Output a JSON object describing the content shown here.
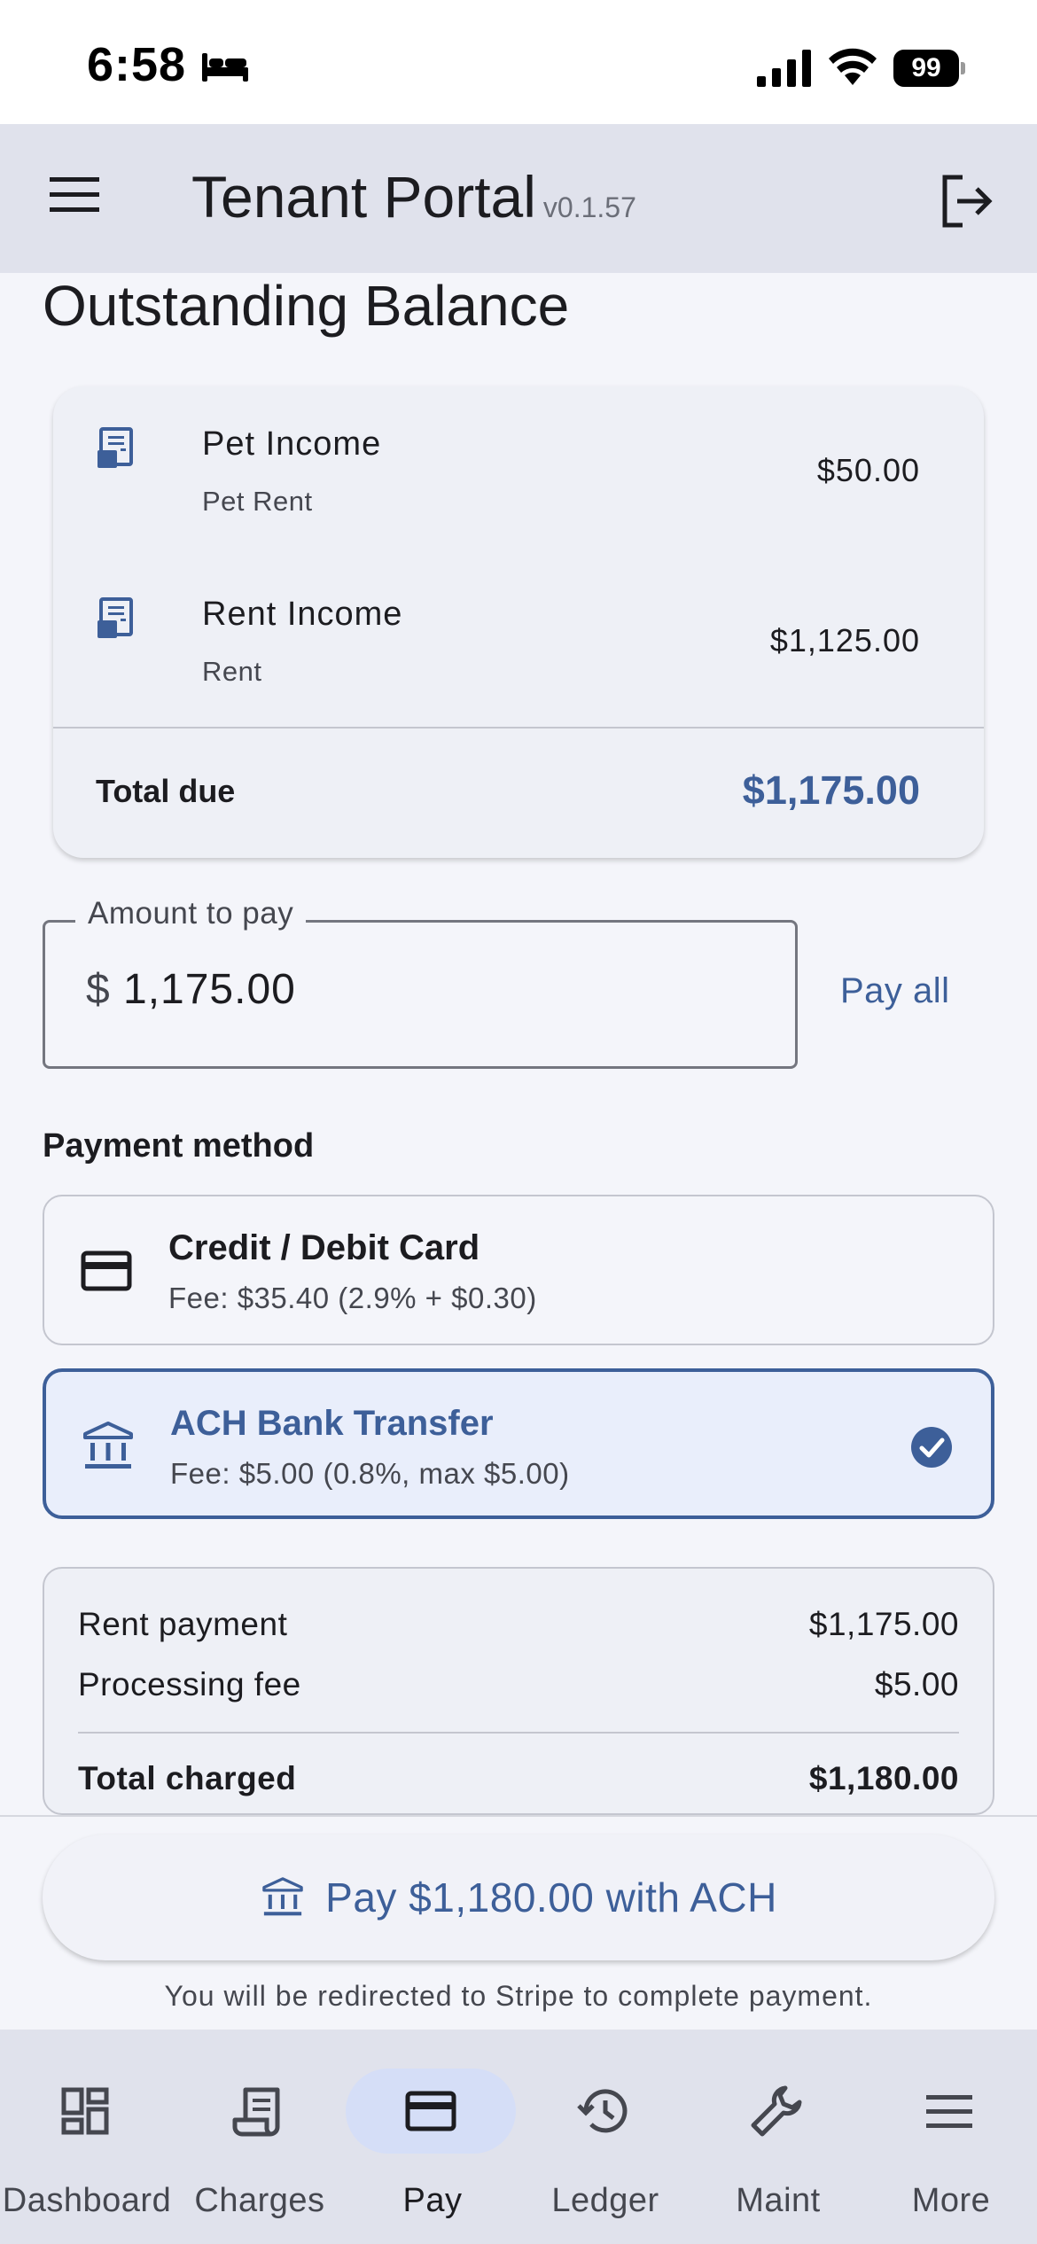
{
  "status_bar": {
    "time": "6:58",
    "battery": "99"
  },
  "app_bar": {
    "title": "Tenant Portal",
    "version": "v0.1.57"
  },
  "balance": {
    "title": "Outstanding Balance",
    "charges": [
      {
        "name": "Pet Income",
        "category": "Pet Rent",
        "amount": "$50.00"
      },
      {
        "name": "Rent Income",
        "category": "Rent",
        "amount": "$1,125.00"
      }
    ],
    "total_label": "Total due",
    "total_value": "$1,175.00"
  },
  "amount": {
    "label": "Amount to pay",
    "prefix": "$",
    "value": "1,175.00",
    "pay_all": "Pay all"
  },
  "payment_method": {
    "label": "Payment method",
    "options": [
      {
        "title": "Credit / Debit Card",
        "fee": "Fee: $35.40  (2.9% + $0.30)",
        "icon": "credit-card-icon",
        "selected": false
      },
      {
        "title": "ACH Bank Transfer",
        "fee": "Fee: $5.00  (0.8%, max $5.00)",
        "icon": "bank-icon",
        "selected": true
      }
    ]
  },
  "summary": {
    "rent_label": "Rent payment",
    "rent_value": "$1,175.00",
    "fee_label": "Processing fee",
    "fee_value": "$5.00",
    "total_label": "Total charged",
    "total_value": "$1,180.00"
  },
  "pay_button": {
    "label": "Pay $1,180.00 with ACH",
    "note": "You will be redirected to Stripe to complete payment."
  },
  "nav": {
    "items": [
      {
        "label": "Dashboard",
        "icon": "dashboard-icon",
        "active": false
      },
      {
        "label": "Charges",
        "icon": "receipt-icon",
        "active": false
      },
      {
        "label": "Pay",
        "icon": "credit-card-icon",
        "active": true
      },
      {
        "label": "Ledger",
        "icon": "history-icon",
        "active": false
      },
      {
        "label": "Maint",
        "icon": "wrench-icon",
        "active": false
      },
      {
        "label": "More",
        "icon": "menu-icon",
        "active": false
      }
    ]
  },
  "colors": {
    "accent": "#3d5f99",
    "app_bar": "#e0e2ec",
    "background": "#f4f5fa",
    "selected_bg": "#e9eefb"
  }
}
